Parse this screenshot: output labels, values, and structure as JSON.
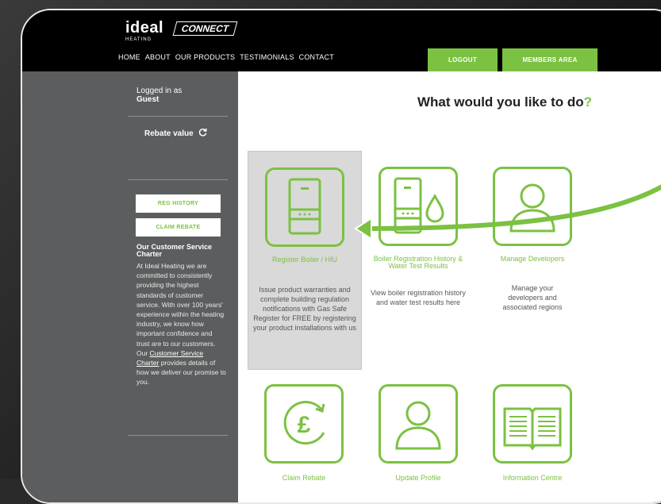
{
  "header": {
    "logo_word": "ideal",
    "logo_sub": "HEATING",
    "logo_connect": "CONNECT",
    "nav": [
      "HOME",
      "ABOUT",
      "OUR PRODUCTS",
      "TESTIMONIALS",
      "CONTACT"
    ],
    "logout_label": "LOGOUT",
    "members_label": "MEMBERS AREA"
  },
  "sidebar": {
    "logged_in_label": "Logged in as",
    "user": "Guest",
    "rebate_label": "Rebate value",
    "reg_history_label": "REG HISTORY",
    "claim_rebate_label": "CLAIM REBATE",
    "charter_title": "Our Customer Service Charter",
    "charter_text_1": "At Ideal Heating we are committed to consistently providing the highest standards of customer service. With over 100 years' experience within the heating industry, we know how important confidence and trust are to our customers. Our ",
    "charter_link": "Customer Service Charter",
    "charter_text_2": " provides details of how we deliver our promise to you."
  },
  "main": {
    "title": "What would you like to do",
    "title_q": "?",
    "tiles": [
      {
        "label": "Register Boiler / HIU",
        "desc": "Issue product warranties and complete building regulation notifications with Gas Safe Register for FREE by registering your product installations with us",
        "icon": "boiler-icon"
      },
      {
        "label": "Boiler Registration History & Water Test Results",
        "desc": "View boiler registration history and water test results here",
        "icon": "boiler-water-icon"
      },
      {
        "label": "Manage Developers",
        "desc": "Manage your developers and associated regions",
        "icon": "user-icon"
      },
      {
        "label": "Claim Rebate",
        "icon": "pound-rebate-icon"
      },
      {
        "label": "Update Profile",
        "icon": "user-icon"
      },
      {
        "label": "Information Centre",
        "icon": "book-icon"
      }
    ]
  },
  "colors": {
    "accent": "#7bc142",
    "sidebar": "#5b5d5e",
    "header": "#000000"
  }
}
